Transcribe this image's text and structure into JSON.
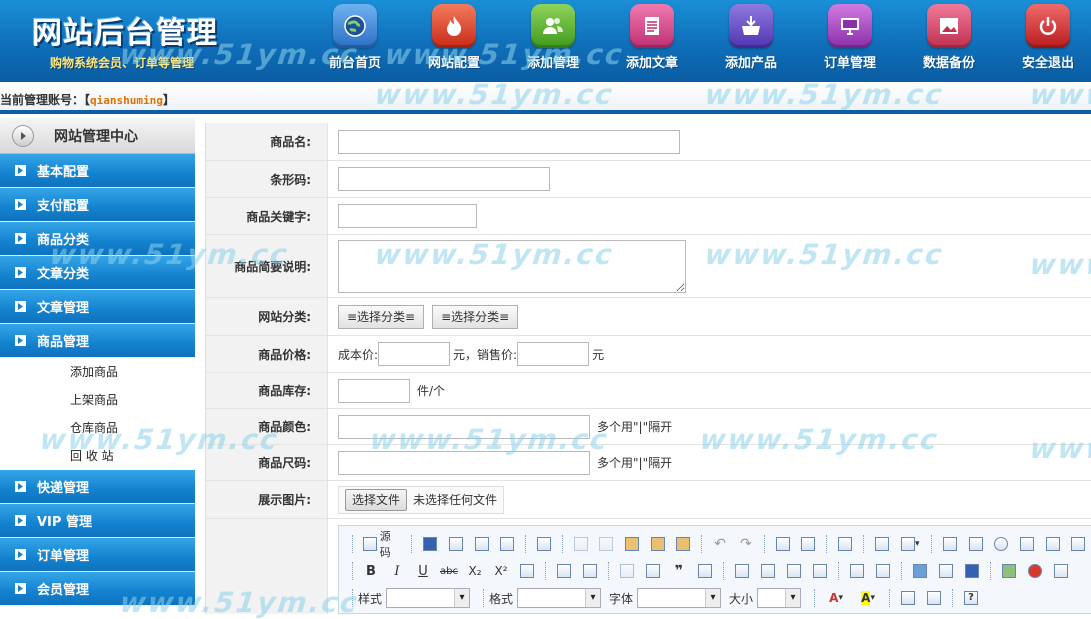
{
  "header": {
    "logo_title": "网站后台管理",
    "logo_subtitle": "购物系统会员、订单等管理",
    "nav": [
      {
        "label": "前台首页",
        "icon": "globe-icon",
        "color": "#3a7fd0"
      },
      {
        "label": "网站配置",
        "icon": "fire-icon",
        "color": "#e0442a"
      },
      {
        "label": "添加管理",
        "icon": "users-icon",
        "color": "#5cb030"
      },
      {
        "label": "添加文章",
        "icon": "document-icon",
        "color": "#d04a8a"
      },
      {
        "label": "添加产品",
        "icon": "basket-icon",
        "color": "#6a4fc0"
      },
      {
        "label": "订单管理",
        "icon": "monitor-icon",
        "color": "#a847b8"
      },
      {
        "label": "数据备份",
        "icon": "image-icon",
        "color": "#d04a70"
      },
      {
        "label": "安全退出",
        "icon": "power-icon",
        "color": "#d83030"
      }
    ]
  },
  "admin_bar": {
    "label": "当前管理账号：",
    "bracket_open": "【",
    "username": "qianshuming",
    "bracket_close": "】"
  },
  "sidebar": {
    "title": "网站管理中心",
    "items_top": [
      {
        "label": "基本配置"
      },
      {
        "label": "支付配置"
      },
      {
        "label": "商品分类"
      },
      {
        "label": "文章分类"
      },
      {
        "label": "文章管理"
      },
      {
        "label": "商品管理"
      }
    ],
    "sub_items": [
      {
        "label": "添加商品"
      },
      {
        "label": "上架商品"
      },
      {
        "label": "仓库商品"
      },
      {
        "label": "回 收 站"
      }
    ],
    "items_bottom": [
      {
        "label": "快递管理"
      },
      {
        "label": "VIP 管理"
      },
      {
        "label": "订单管理"
      },
      {
        "label": "会员管理"
      }
    ]
  },
  "form": {
    "name_label": "商品名:",
    "barcode_label": "条形码:",
    "keywords_label": "商品关键字:",
    "desc_label": "商品简要说明:",
    "category_label": "网站分类:",
    "category_btn1": "≡选择分类≡",
    "category_btn2": "≡选择分类≡",
    "price_label": "商品价格:",
    "cost_label": "成本价:",
    "cost_unit": "元，销售价:",
    "sale_unit": "元",
    "stock_label": "商品库存:",
    "stock_unit": "件/个",
    "color_label": "商品颜色:",
    "color_hint": "多个用\"|\"隔开",
    "size_label": "商品尺码:",
    "size_hint": "多个用\"|\"隔开",
    "image_label": "展示图片:",
    "file_button": "选择文件",
    "file_status": "未选择任何文件"
  },
  "editor": {
    "source_label": "源码",
    "style_label": "样式",
    "format_label": "格式",
    "font_label": "字体",
    "size_label": "大小",
    "bold": "B",
    "italic": "I",
    "underline": "U",
    "strike": "abc",
    "subscript": "X₂",
    "superscript": "X²"
  },
  "watermark_text": "www.51ym.cc"
}
